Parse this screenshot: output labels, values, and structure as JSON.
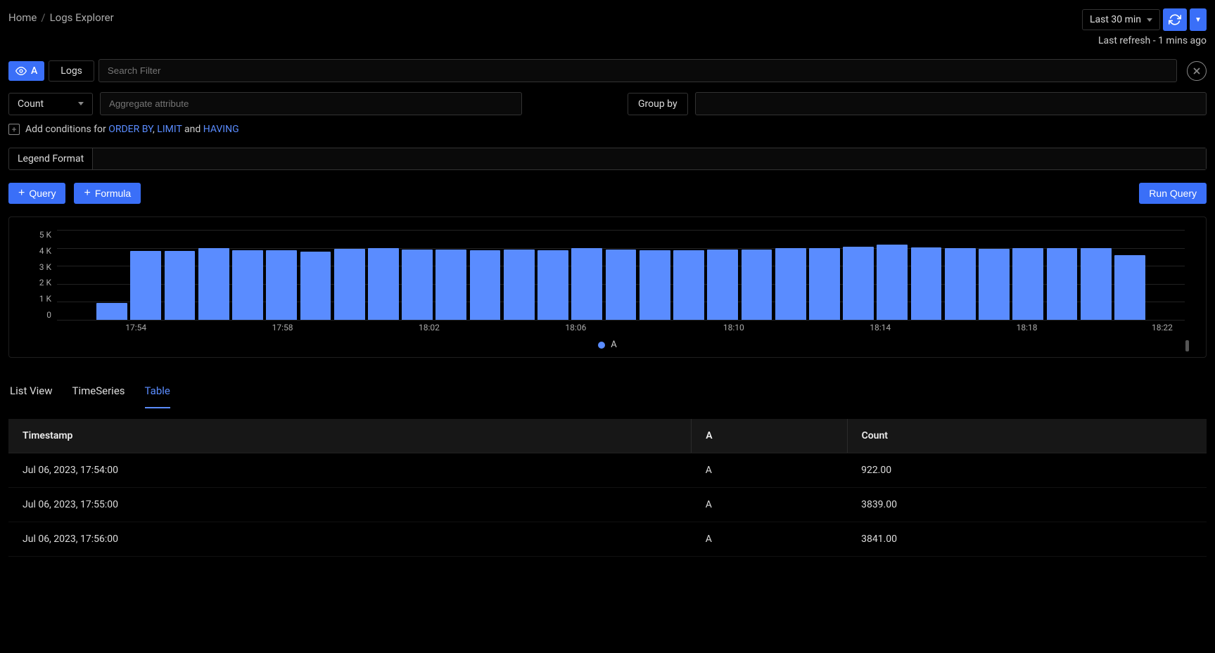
{
  "breadcrumb": {
    "home": "Home",
    "page": "Logs Explorer"
  },
  "timeRange": {
    "label": "Last 30 min"
  },
  "lastRefresh": "Last refresh - 1 mins ago",
  "query": {
    "badge": "A",
    "source": "Logs",
    "searchPlaceholder": "Search Filter",
    "aggFn": "Count",
    "aggPlaceholder": "Aggregate attribute",
    "groupByLabel": "Group by",
    "condPrefix": "Add conditions for ",
    "orderBy": "ORDER BY",
    "sepComma": ", ",
    "limit": "LIMIT",
    "sepAnd": " and ",
    "having": "HAVING",
    "legendLabel": "Legend Format"
  },
  "buttons": {
    "query": "Query",
    "formula": "Formula",
    "run": "Run Query"
  },
  "chart_data": {
    "type": "bar",
    "series_name": "A",
    "ylabel": "",
    "ylim": [
      0,
      5000
    ],
    "y_ticks": [
      "5 K",
      "4 K",
      "3 K",
      "2 K",
      "1 K",
      "0"
    ],
    "x_ticks": [
      {
        "pos": 7,
        "label": "17:54"
      },
      {
        "pos": 20,
        "label": "17:58"
      },
      {
        "pos": 33,
        "label": "18:02"
      },
      {
        "pos": 46,
        "label": "18:06"
      },
      {
        "pos": 60,
        "label": "18:10"
      },
      {
        "pos": 73,
        "label": "18:14"
      },
      {
        "pos": 86,
        "label": "18:18"
      },
      {
        "pos": 98,
        "label": "18:22"
      }
    ],
    "values": [
      922,
      3839,
      3841,
      3995,
      3880,
      3870,
      3780,
      3940,
      3990,
      3900,
      3910,
      3870,
      3900,
      3880,
      3990,
      3890,
      3870,
      3880,
      3890,
      3900,
      3980,
      3970,
      4050,
      4180,
      4010,
      3970,
      3960,
      3980,
      3970,
      3980,
      3600
    ]
  },
  "tabs": {
    "list": "List View",
    "ts": "TimeSeries",
    "table": "Table",
    "active": "table"
  },
  "table": {
    "columns": [
      "Timestamp",
      "A",
      "Count"
    ],
    "rows": [
      {
        "ts": "Jul 06, 2023, 17:54:00",
        "a": "A",
        "count": "922.00"
      },
      {
        "ts": "Jul 06, 2023, 17:55:00",
        "a": "A",
        "count": "3839.00"
      },
      {
        "ts": "Jul 06, 2023, 17:56:00",
        "a": "A",
        "count": "3841.00"
      }
    ]
  }
}
